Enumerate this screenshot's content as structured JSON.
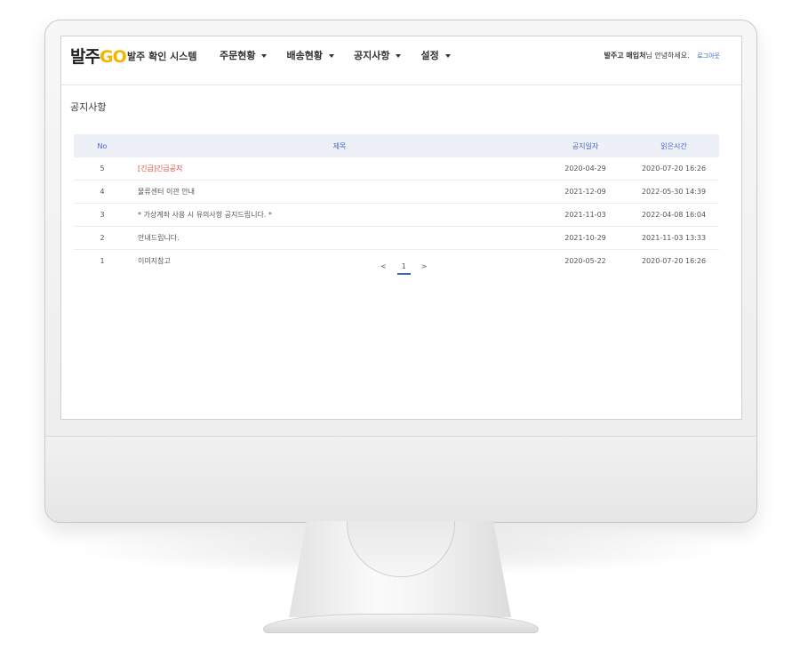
{
  "header": {
    "logo_main": "발주",
    "logo_go": "GO",
    "brand": "발주 확인 시스템",
    "nav": [
      "주문현황",
      "배송현황",
      "공지사항",
      "설정"
    ],
    "user_name": "발주고 매입처",
    "user_greeting": "님 안녕하세요.",
    "logout": "로그아웃"
  },
  "page_title": "공지사항",
  "table": {
    "columns": [
      "No",
      "제목",
      "공지일자",
      "읽은시간"
    ],
    "rows": [
      {
        "no": "5",
        "title": "[긴급]긴급공지",
        "date": "2020-04-29",
        "read": "2020-07-20 16:26"
      },
      {
        "no": "4",
        "title": "물류센터 이관 안내",
        "date": "2021-12-09",
        "read": "2022-05-30 14:39"
      },
      {
        "no": "3",
        "title": "* 가상계좌 사용 시 유의사항 공지드립니다. *",
        "date": "2021-11-03",
        "read": "2022-04-08 16:04"
      },
      {
        "no": "2",
        "title": "안내드립니다.",
        "date": "2021-10-29",
        "read": "2021-11-03 13:33"
      },
      {
        "no": "1",
        "title": "이미지참고",
        "date": "2020-05-22",
        "read": "2020-07-20 16:26"
      }
    ]
  },
  "pager": {
    "prev": "<",
    "current": "1",
    "next": ">"
  },
  "colors": {
    "accent": "#3366cc",
    "header_bg": "#eef0f7",
    "urgent": "#e04a3a",
    "logo_go": "#f5b400"
  }
}
